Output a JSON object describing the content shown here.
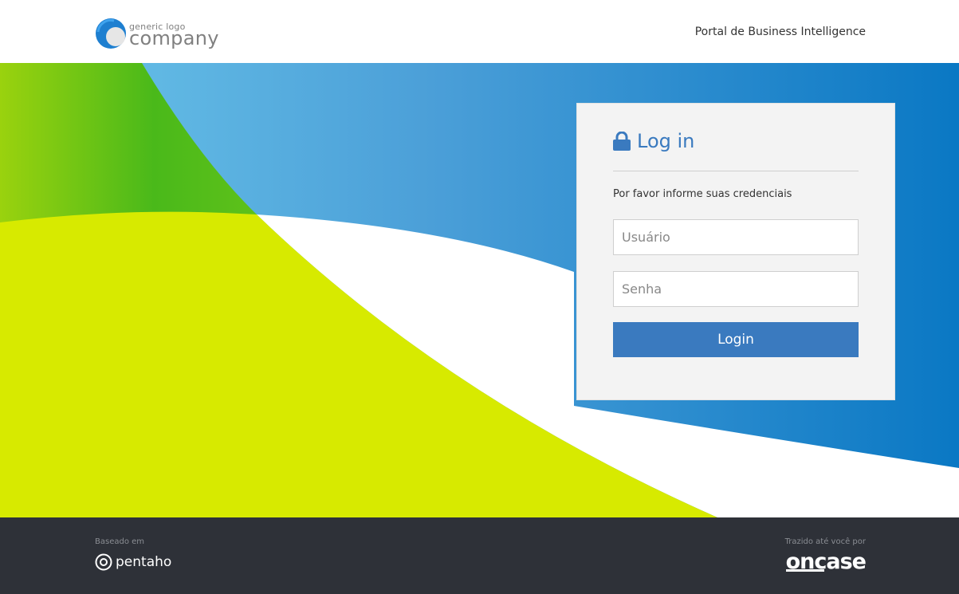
{
  "header": {
    "logo_small": "generic logo",
    "logo_big": "company",
    "portal_title": "Portal de Business Intelligence"
  },
  "login_card": {
    "title": "Log in",
    "subtitle": "Por favor informe suas credenciais",
    "username_placeholder": "Usuário",
    "password_placeholder": "Senha",
    "login_button": "Login"
  },
  "footer": {
    "based_on_label": "Baseado em",
    "pentaho_text": "pentaho",
    "brought_by_label": "Trazido até você por",
    "oncase_text": "oncase"
  },
  "icons": {
    "lock": "lock-icon",
    "logo": "company-logo-icon",
    "pentaho": "pentaho-icon"
  },
  "colors": {
    "accent_blue": "#3a7abf",
    "footer_bg": "#2e3138",
    "card_bg": "#f3f3f3",
    "hero_green": "#d7ea00",
    "hero_blue": "#0a78c4"
  }
}
